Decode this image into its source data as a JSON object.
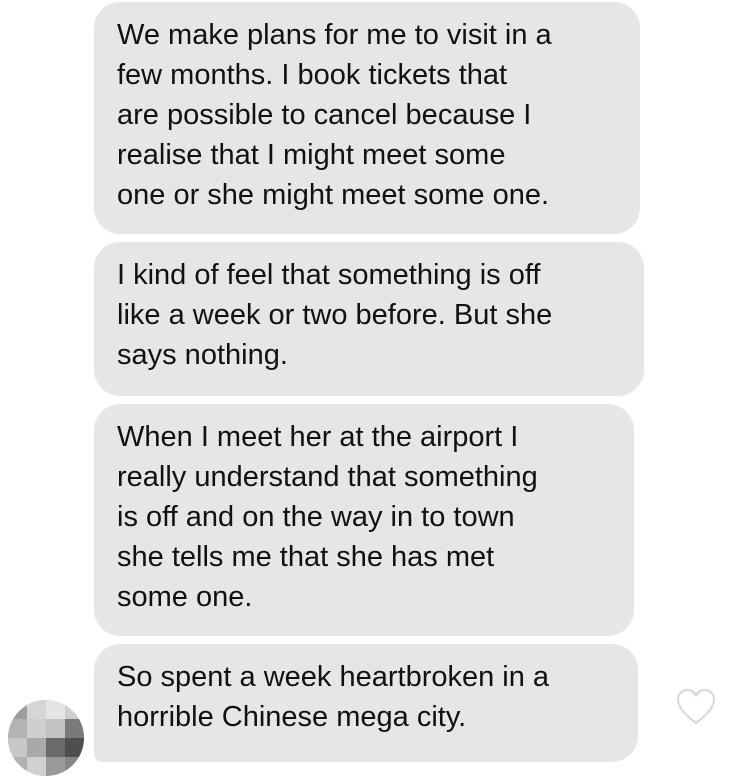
{
  "messages": [
    {
      "lines": [
        "We make plans for me to visit in a",
        "few months. I book tickets that",
        "are possible to cancel because I",
        "realise that I might meet some",
        "one or she might meet some one."
      ]
    },
    {
      "lines": [
        "I kind of feel that something is off",
        "like a week or two before. But she",
        "says nothing."
      ]
    },
    {
      "lines": [
        "When I meet her at the airport I",
        "really understand that something",
        "is off and on the way in to town",
        "she tells me that she has met",
        "some one."
      ]
    },
    {
      "lines": [
        "So spent a week heartbroken in a",
        "horrible Chinese mega city."
      ]
    }
  ],
  "icons": {
    "avatar": "blurred-avatar",
    "like": "heart-outline-icon"
  },
  "colors": {
    "bubble": "#e6e6e6",
    "text": "#111111",
    "heart_stroke": "#d9d9d9"
  }
}
